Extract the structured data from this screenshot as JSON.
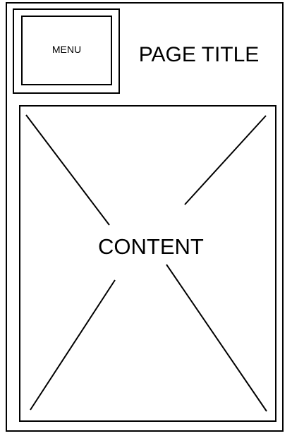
{
  "header": {
    "menu_label": "MENU",
    "page_title": "PAGE TITLE"
  },
  "main": {
    "content_label": "CONTENT"
  }
}
